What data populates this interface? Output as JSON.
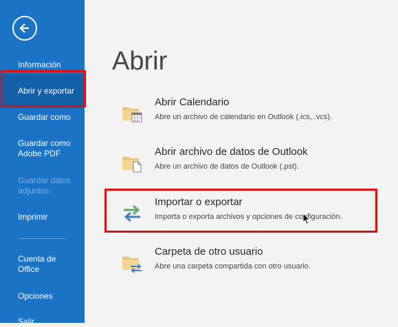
{
  "sidebar": {
    "items": [
      {
        "label": "Información"
      },
      {
        "label": "Abrir y exportar"
      },
      {
        "label": "Guardar como"
      },
      {
        "label": "Guardar como Adobe PDF"
      },
      {
        "label": "Guardar datos adjuntos"
      },
      {
        "label": "Imprimir"
      },
      {
        "label": "Cuenta de Office"
      },
      {
        "label": "Opciones"
      },
      {
        "label": "Salir"
      }
    ]
  },
  "main": {
    "title": "Abrir",
    "options": [
      {
        "title": "Abrir Calendario",
        "description": "Abre un archivo de calendario en Outlook (.ics, .vcs).",
        "icon": "folder-calendar-icon"
      },
      {
        "title": "Abrir archivo de datos de Outlook",
        "description": "Abre un archivo de datos de Outlook (.pst).",
        "icon": "folder-file-icon"
      },
      {
        "title": "Importar o exportar",
        "description": "Importa o exporta archivos y opciones de configuración.",
        "icon": "import-export-icon"
      },
      {
        "title": "Carpeta de otro usuario",
        "description": "Abre una carpeta compartida con otro usuario.",
        "icon": "shared-folder-icon"
      }
    ]
  },
  "colors": {
    "sidebar": "#1a73c5",
    "sidebar_selected": "#135fa8",
    "highlight": "#e01010",
    "background": "#f3f3f3"
  }
}
